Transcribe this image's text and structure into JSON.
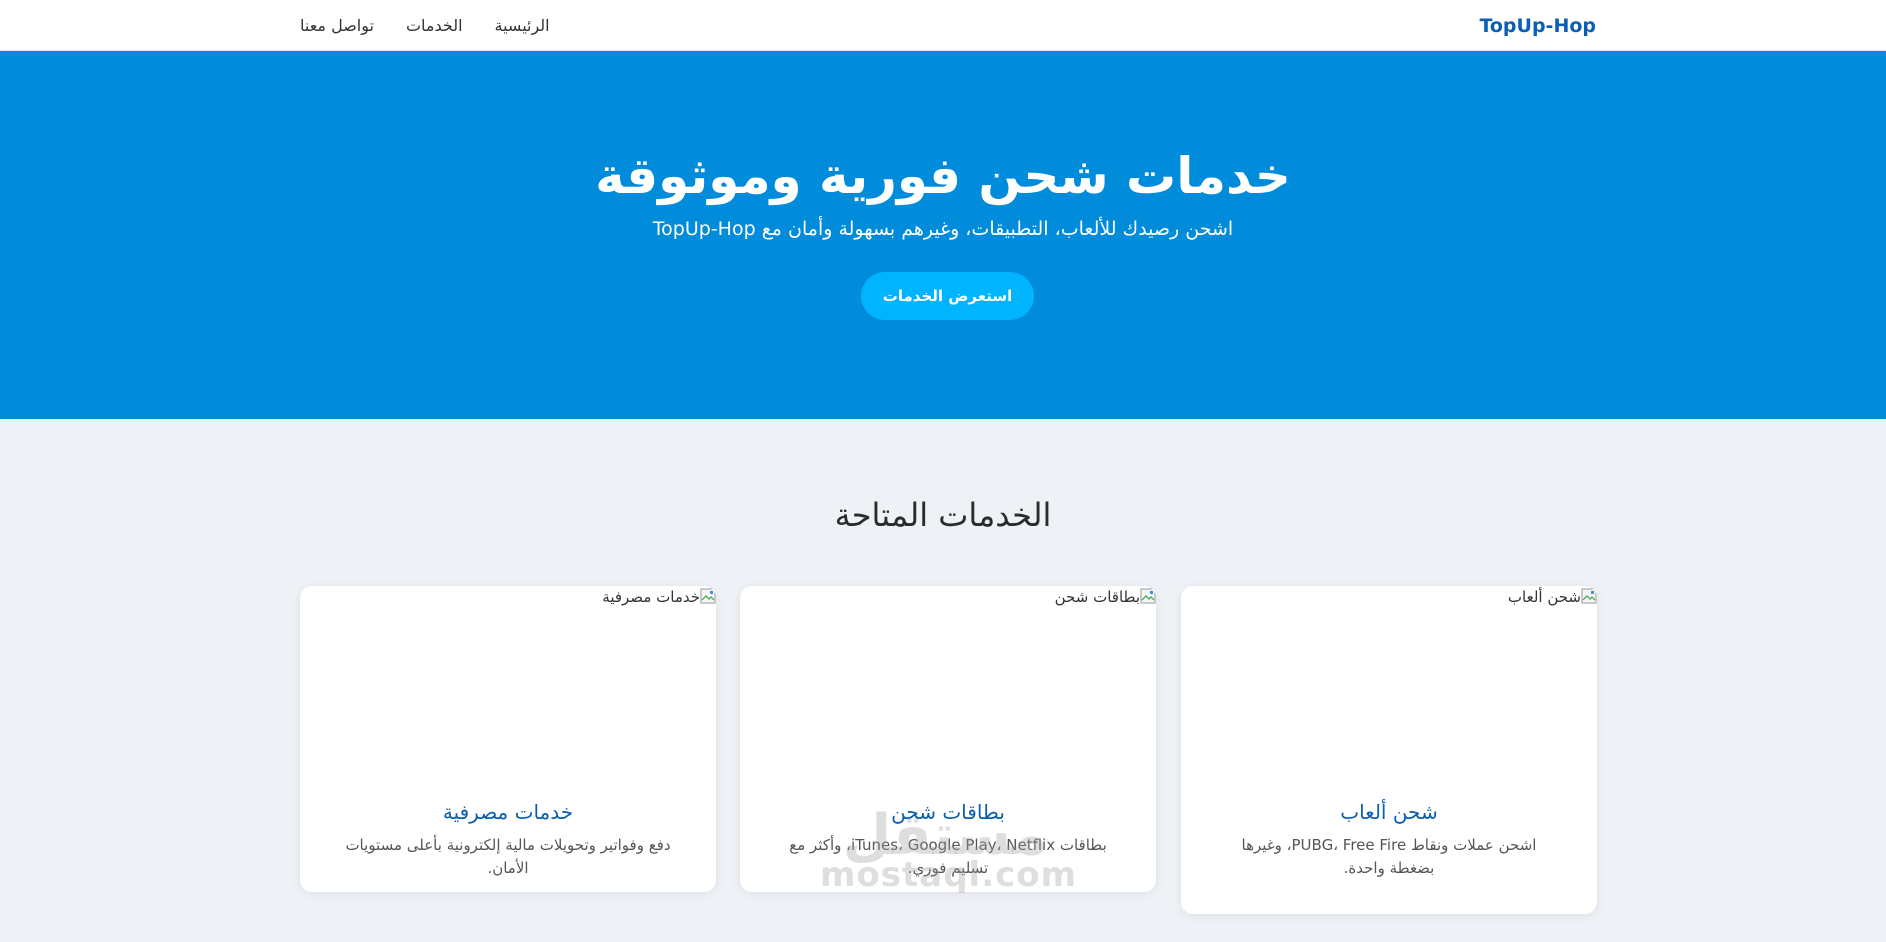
{
  "header": {
    "brand": "TopUp-Hop",
    "nav": [
      {
        "label": "الرئيسية"
      },
      {
        "label": "الخدمات"
      },
      {
        "label": "تواصل معنا"
      }
    ]
  },
  "hero": {
    "title": "خدمات شحن فورية وموثوقة",
    "subtitle": "اشحن رصيدك للألعاب، التطبيقات، وغيرهم بسهولة وأمان مع TopUp-Hop",
    "button_label": "استعرض الخدمات"
  },
  "services": {
    "title": "الخدمات المتاحة",
    "cards": [
      {
        "image_alt": "شحن ألعاب",
        "title": "شحن ألعاب",
        "description": "اشحن عملات ونقاط PUBG، Free Fire، وغيرها بضغطة واحدة."
      },
      {
        "image_alt": "بطاقات شحن",
        "title": "بطاقات شحن",
        "description": "بطاقات iTunes، Google Play، Netflix، وأكثر مع تسليم فوري."
      },
      {
        "image_alt": "خدمات مصرفية",
        "title": "خدمات مصرفية",
        "description": "دفع وفواتير وتحويلات مالية إلكترونية بأعلى مستويات الأمان."
      }
    ]
  },
  "watermark": {
    "arabic": "مستقل",
    "latin": "mostaql.com"
  },
  "colors": {
    "brand": "#0a5fb4",
    "hero_bg": "#008bdb",
    "button_bg": "#00b4ff",
    "page_bg": "#eef2f6"
  },
  "icons": {
    "broken_image": "broken-image-icon"
  }
}
